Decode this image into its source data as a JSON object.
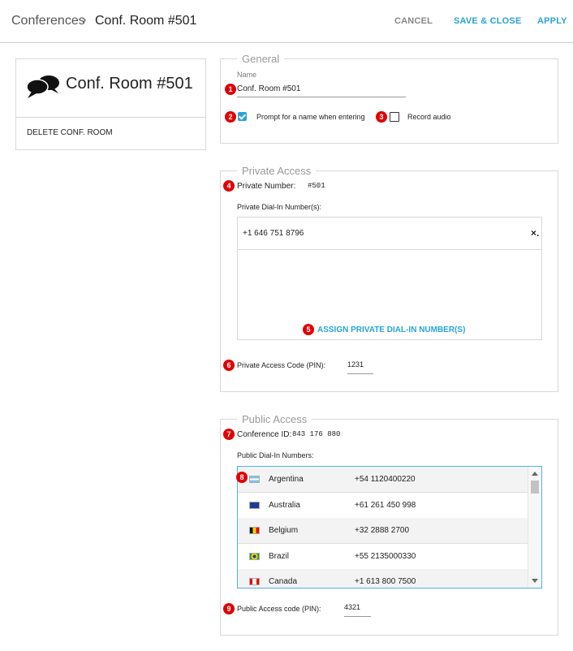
{
  "header": {
    "breadcrumb_root": "Conferences",
    "breadcrumb_sep": "›",
    "breadcrumb_current": "Conf. Room #501",
    "cancel_label": "CANCEL",
    "save_close_label": "SAVE & CLOSE",
    "apply_label": "APPLY"
  },
  "card": {
    "icon": "chat-bubbles-icon",
    "title": "Conf. Room #501",
    "delete_label": "DELETE CONF. ROOM"
  },
  "general": {
    "title": "General",
    "name_label": "Name",
    "name_value": "Conf. Room #501",
    "prompt_label": "Prompt for a name when entering",
    "prompt_checked": true,
    "record_label": "Record audio",
    "record_checked": false
  },
  "private_access": {
    "title": "Private Access",
    "number_label": "Private Number:",
    "number_value": "#501",
    "dialin_label": "Private Dial-In Number(s):",
    "dialin_numbers": [
      "+1 646 751 8796"
    ],
    "remove_glyph": "×.",
    "assign_label": "ASSIGN PRIVATE DIAL-IN NUMBER(S)",
    "pin_label": "Private Access Code (PIN):",
    "pin_value": "1231"
  },
  "public_access": {
    "title": "Public Access",
    "conf_id_label": "Conference ID:",
    "conf_id_value": "843 176 880",
    "dialin_label": "Public Dial-In Numbers:",
    "numbers": [
      {
        "country": "Argentina",
        "number": "+54 1120400220"
      },
      {
        "country": "Australia",
        "number": "+61 261 450 998"
      },
      {
        "country": "Belgium",
        "number": "+32 2888 2700"
      },
      {
        "country": "Brazil",
        "number": "+55 2135000330"
      },
      {
        "country": "Canada",
        "number": "+1 613 800 7500"
      }
    ],
    "pin_label": "Public Access code (PIN):",
    "pin_value": "4321"
  },
  "markers": [
    "1",
    "2",
    "3",
    "4",
    "5",
    "6",
    "7",
    "8",
    "9"
  ],
  "colors": {
    "accent": "#29a3d6",
    "marker": "#e00000"
  }
}
